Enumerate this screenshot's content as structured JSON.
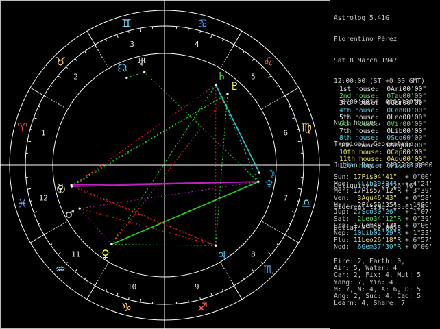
{
  "header": {
    "lines": [
      "Astrolog 5.41G",
      "Florentino Pérez",
      "Sat 8 March 1947",
      "12:00:00 (ST +0:00 GMT)",
      "  0°00'00\"W  0°00'00\"N",
      "Null houses.",
      "Tropical, Geocentric.",
      "Julian Day = 2432253.0000",
      "Obliquity = 23°26'46\"",
      "Sidereal time: 23:01:24",
      "DeltaT =  27.8658"
    ]
  },
  "houses": [
    {
      "label": "1st house:",
      "value": " 0Ari00'00\"",
      "color": "#e0e0e0"
    },
    {
      "label": "2nd house:",
      "value": " 0Tau00'00\"",
      "color": "#55e055"
    },
    {
      "label": "3rd house:",
      "value": " 0Gem00'00\"",
      "color": "#e0e0e0"
    },
    {
      "label": "4th house:",
      "value": " 0Can00'00\"",
      "color": "#55d0e8"
    },
    {
      "label": "5th house:",
      "value": " 0Leo00'00\"",
      "color": "#e0e0e0"
    },
    {
      "label": "6th house:",
      "value": " 0Vir00'00\"",
      "color": "#55e055"
    },
    {
      "label": "7th house:",
      "value": " 0Lib00'00\"",
      "color": "#e0e0e0"
    },
    {
      "label": "8th house:",
      "value": " 0Sco00'00\"",
      "color": "#55d0e8"
    },
    {
      "label": "9th house:",
      "value": " 0Sag00'00\"",
      "color": "#e0e0e0"
    },
    {
      "label": "10th house:",
      "value": " 0Cap00'00\"",
      "color": "#e8e055"
    },
    {
      "label": "11th house:",
      "value": " 0Aqu00'00\"",
      "color": "#e8e055"
    },
    {
      "label": "12th house:",
      "value": " 0Pis00'00\"",
      "color": "#55d0e8"
    }
  ],
  "planets": [
    {
      "name": "Sun:",
      "pos": "17Pis04'41\"",
      "speed": "+ 0°00'",
      "color": "#e8e055"
    },
    {
      "name": "Moo:",
      "pos": " 4Lib39'24\"",
      "speed": "+ 4°24'",
      "color": "#55d0e8"
    },
    {
      "name": "Mer:",
      "pos": "17Pis57'12\"R",
      "speed": "+ 3°39'",
      "color": "#e0e0e0"
    },
    {
      "name": "Ven:",
      "pos": " 3Aqu46'43\"",
      "speed": "+ 0°58'",
      "color": "#e8e055"
    },
    {
      "name": "Mar:",
      "pos": " 2Pis59'35\"",
      "speed": "- 1°06'",
      "color": "#e0e0e0"
    },
    {
      "name": "Jup:",
      "pos": "27Sco30'26\"",
      "speed": "+ 1°07'",
      "color": "#55d0e8"
    },
    {
      "name": "Sat:",
      "pos": " 2Leo34'12\"R",
      "speed": "+ 0°39'",
      "color": "#55e055"
    },
    {
      "name": "Ura:",
      "pos": "17Gem48'13\"",
      "speed": "+ 0°06'",
      "color": "#e0e0e0"
    },
    {
      "name": "Nep:",
      "pos": "10Lib02'29\"R",
      "speed": "+ 1°33'",
      "color": "#55d0e8"
    },
    {
      "name": "Plu:",
      "pos": "11Leo26'18\"R",
      "speed": "+ 6°57'",
      "color": "#e8e055"
    },
    {
      "name": "Nod:",
      "pos": " 6Gem37'30\"R",
      "speed": "+ 0°00'",
      "color": "#55d0e8"
    }
  ],
  "summary": [
    "Fire: 2, Earth: 0,",
    "Air: 5, Water: 4",
    "Car: 2, Fix: 4, Mut: 5",
    "Yang: 7, Yin: 4",
    "M: 7, N: 4, A: 6, D: 5",
    "Ang: 2, Suc: 4, Cad: 5",
    "Learn: 4, Share: 7"
  ],
  "house_numbers": [
    "1",
    "2",
    "3",
    "4",
    "5",
    "6",
    "7",
    "8",
    "9",
    "10",
    "11",
    "12"
  ],
  "colors": {
    "background": "#000000",
    "wheel": "#ffffff",
    "text": "#c8c8c8",
    "red": "#ff2020",
    "green": "#20e020",
    "magenta": "#c020c0",
    "cyan": "#20d0d0",
    "yellow": "#e0e020"
  },
  "wheel_icons": [
    "aries-icon",
    "taurus-icon",
    "gemini-icon",
    "cancer-icon",
    "leo-icon",
    "virgo-icon",
    "libra-icon",
    "scorpio-icon",
    "sagittarius-icon",
    "capricorn-icon",
    "aquarius-icon",
    "pisces-icon"
  ]
}
